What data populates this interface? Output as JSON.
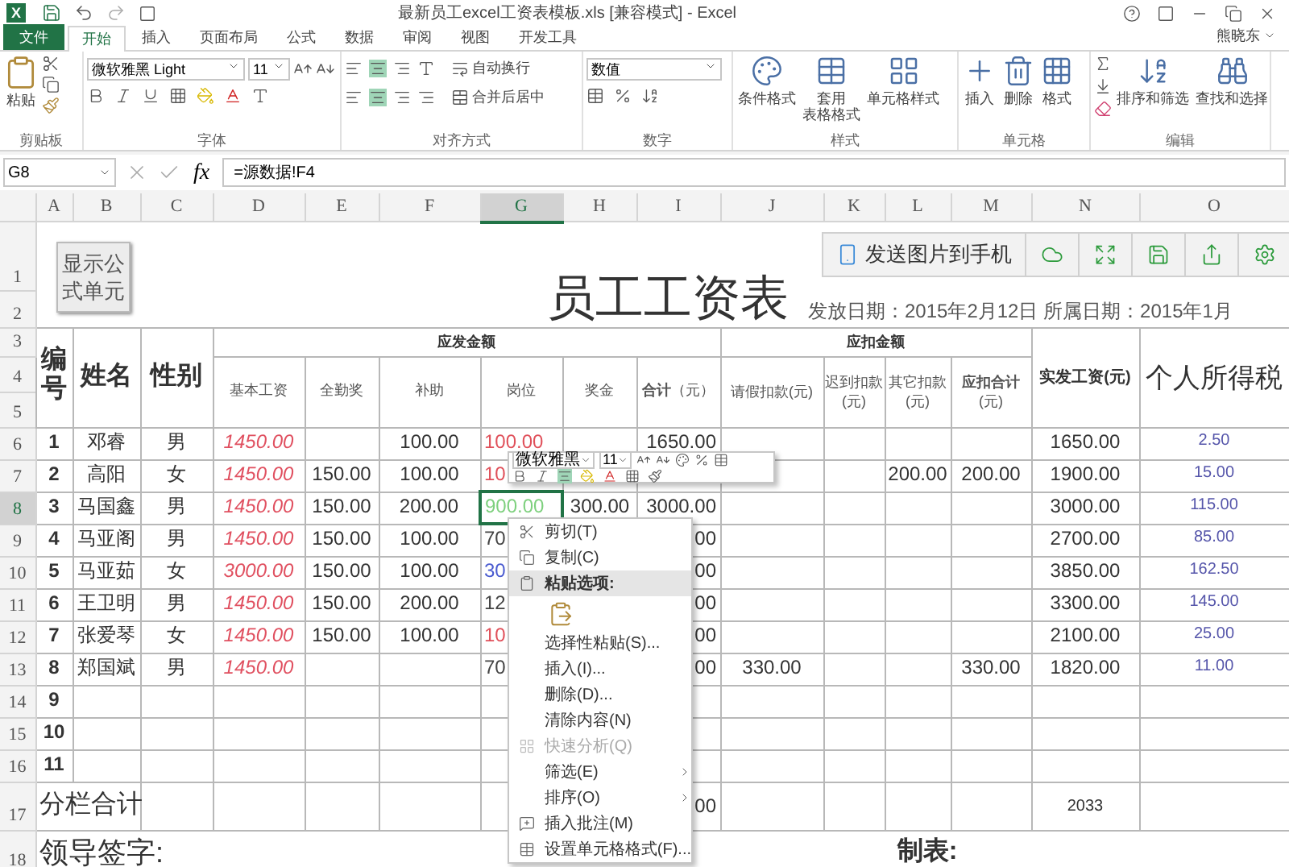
{
  "window": {
    "logo": "X",
    "title": "最新员工excel工资表模板.xls  [兼容模式] - Excel",
    "user": "熊晓东"
  },
  "tabs": [
    {
      "label": "文件",
      "kind": "file",
      "selected": false
    },
    {
      "label": "开始",
      "kind": "tab",
      "selected": true
    },
    {
      "label": "插入",
      "kind": "tab",
      "selected": false
    },
    {
      "label": "页面布局",
      "kind": "tab",
      "selected": false
    },
    {
      "label": "公式",
      "kind": "tab",
      "selected": false
    },
    {
      "label": "数据",
      "kind": "tab",
      "selected": false
    },
    {
      "label": "审阅",
      "kind": "tab",
      "selected": false
    },
    {
      "label": "视图",
      "kind": "tab",
      "selected": false
    },
    {
      "label": "开发工具",
      "kind": "tab",
      "selected": false
    }
  ],
  "ribbon": {
    "clipboard": {
      "paste": "粘贴",
      "group": "剪贴板"
    },
    "font": {
      "name": "微软雅黑 Light",
      "size": "11",
      "group": "字体"
    },
    "alignment": {
      "wrap": "自动换行",
      "merge": "合并后居中",
      "group": "对齐方式"
    },
    "number": {
      "format": "数值",
      "group": "数字"
    },
    "styles": {
      "buttons": [
        {
          "label": "条件格式"
        },
        {
          "label": "套用",
          "label_2": "表格格式"
        },
        {
          "label": "单元格样式"
        }
      ],
      "group": "样式"
    },
    "cells": {
      "buttons": [
        "插入",
        "删除",
        "格式"
      ],
      "group": "单元格"
    },
    "editing": {
      "buttons": [
        "排序和筛选",
        "查找和选择"
      ],
      "group": "编辑"
    }
  },
  "formula_bar": {
    "name_box": "G8",
    "function_button": "fx",
    "formula": "=源数据!F4"
  },
  "columns": [
    {
      "label": "A",
      "selected": false
    },
    {
      "label": "B",
      "selected": false
    },
    {
      "label": "C",
      "selected": false
    },
    {
      "label": "D",
      "selected": false
    },
    {
      "label": "E",
      "selected": false
    },
    {
      "label": "F",
      "selected": false
    },
    {
      "label": "G",
      "selected": true
    },
    {
      "label": "H",
      "selected": false
    },
    {
      "label": "I",
      "selected": false
    },
    {
      "label": "J",
      "selected": false
    },
    {
      "label": "K",
      "selected": false
    },
    {
      "label": "L",
      "selected": false
    },
    {
      "label": "M",
      "selected": false
    },
    {
      "label": "N",
      "selected": false
    },
    {
      "label": "O",
      "selected": false
    }
  ],
  "row_headers": [
    {
      "label": "1",
      "selected": false
    },
    {
      "label": "2",
      "selected": false
    },
    {
      "label": "3",
      "selected": false
    },
    {
      "label": "4",
      "selected": false
    },
    {
      "label": "5",
      "selected": false
    },
    {
      "label": "6",
      "selected": false
    },
    {
      "label": "7",
      "selected": false
    },
    {
      "label": "8",
      "selected": true
    },
    {
      "label": "9",
      "selected": false
    },
    {
      "label": "10",
      "selected": false
    },
    {
      "label": "11",
      "selected": false
    },
    {
      "label": "12",
      "selected": false
    },
    {
      "label": "13",
      "selected": false
    },
    {
      "label": "14",
      "selected": false
    },
    {
      "label": "15",
      "selected": false
    },
    {
      "label": "16",
      "selected": false
    },
    {
      "label": "17",
      "selected": false
    },
    {
      "label": "18",
      "selected": false
    }
  ],
  "formula_button": {
    "label": "显示公式单元"
  },
  "float_toolbar": {
    "send_label": "发送图片到手机"
  },
  "title_block": {
    "title": "员工工资表",
    "dates": "发放日期：2015年2月12日 所属日期：2015年1月"
  },
  "header": {
    "id": "编号",
    "name": "姓名",
    "gender": "性别",
    "earnings_group": "应发金额",
    "earnings": [
      "基本工资",
      "全勤奖",
      "补助",
      "岗位",
      "奖金",
      "**合计**（元）"
    ],
    "deductions_group": "应扣金额",
    "deductions": [
      "请假扣款(元)",
      "迟到扣款(元)",
      "其它扣款(元)",
      "**应扣合计**(元)"
    ],
    "net_pay": "实发工资(元)",
    "tax": "个人所得税"
  },
  "rows": [
    {
      "color": "#e0505a",
      "cells": [
        "1",
        "邓睿",
        "男",
        "1450.00",
        "",
        "100.00",
        "100.00",
        "",
        "1650.00",
        "",
        "",
        "",
        "",
        "1650.00",
        "2.50"
      ]
    },
    {
      "color": "#e0505a",
      "cells": [
        "2",
        "高阳",
        "女",
        "1450.00",
        "150.00",
        "100.00",
        "10",
        "",
        "",
        "",
        "",
        "200.00",
        "200.00",
        "1900.00",
        "15.00"
      ]
    },
    {
      "color": "#7ed07e",
      "cells": [
        "3",
        "马国鑫",
        "男",
        "1450.00",
        "150.00",
        "200.00",
        "900.00",
        "300.00",
        "3000.00",
        "",
        "",
        "",
        "",
        "3000.00",
        "115.00"
      ]
    },
    {
      "color": "#444444",
      "cells": [
        "4",
        "马亚阁",
        "男",
        "1450.00",
        "150.00",
        "100.00",
        "70",
        "",
        "00",
        "",
        "",
        "",
        "",
        "2700.00",
        "85.00"
      ]
    },
    {
      "color": "#4a5bd0",
      "cells": [
        "5",
        "马亚茹",
        "女",
        "3000.00",
        "150.00",
        "100.00",
        "30",
        "",
        "00",
        "",
        "",
        "",
        "",
        "3850.00",
        "162.50"
      ]
    },
    {
      "color": "#444444",
      "cells": [
        "6",
        "王卫明",
        "男",
        "1450.00",
        "150.00",
        "200.00",
        "12",
        "",
        "00",
        "",
        "",
        "",
        "",
        "3300.00",
        "145.00"
      ]
    },
    {
      "color": "#e0505a",
      "cells": [
        "7",
        "张爱琴",
        "女",
        "1450.00",
        "150.00",
        "100.00",
        "10",
        "",
        "00",
        "",
        "",
        "",
        "",
        "2100.00",
        "25.00"
      ]
    },
    {
      "color": "#444444",
      "cells": [
        "8",
        "郑国斌",
        "男",
        "1450.00",
        "",
        "",
        "70",
        "",
        "00",
        "330.00",
        "",
        "",
        "330.00",
        "1820.00",
        "11.00"
      ]
    },
    {
      "cells": [
        "9",
        "",
        "",
        "",
        "",
        "",
        "",
        "",
        "",
        "",
        "",
        "",
        "",
        "",
        ""
      ]
    },
    {
      "cells": [
        "10",
        "",
        "",
        "",
        "",
        "",
        "",
        "",
        "",
        "",
        "",
        "",
        "",
        "",
        ""
      ]
    },
    {
      "cells": [
        "11",
        "",
        "",
        "",
        "",
        "",
        "",
        "",
        "",
        "",
        "",
        "",
        "",
        "",
        ""
      ]
    }
  ],
  "subtotal": {
    "label": "分栏合计",
    "total": "00",
    "net_total": "2033"
  },
  "signatures": {
    "leader": "领导签字:",
    "preparer": "制表:"
  },
  "mini_toolbar": {
    "font": "微软雅黑",
    "size": "11"
  },
  "context_menu": [
    {
      "kind": "item",
      "label": "剪切(T)",
      "disabled": false,
      "highlighted": false
    },
    {
      "kind": "item",
      "label": "复制(C)",
      "disabled": false,
      "highlighted": false
    },
    {
      "kind": "header",
      "label": "粘贴选项:",
      "disabled": false,
      "highlighted": true
    },
    {
      "kind": "paste_icon",
      "disabled": false,
      "highlighted": false
    },
    {
      "kind": "item",
      "label": "选择性粘贴(S)...",
      "disabled": false,
      "highlighted": false
    },
    {
      "kind": "item",
      "label": "插入(I)...",
      "disabled": false,
      "highlighted": false
    },
    {
      "kind": "item",
      "label": "删除(D)...",
      "disabled": false,
      "highlighted": false
    },
    {
      "kind": "item",
      "label": "清除内容(N)",
      "disabled": false,
      "highlighted": false
    },
    {
      "kind": "item",
      "label": "快速分析(Q)",
      "disabled": true,
      "highlighted": false
    },
    {
      "kind": "submenu",
      "label": "筛选(E)",
      "disabled": false,
      "highlighted": false
    },
    {
      "kind": "submenu",
      "label": "排序(O)",
      "disabled": false,
      "highlighted": false
    },
    {
      "kind": "item",
      "label": "插入批注(M)",
      "disabled": false,
      "highlighted": false
    },
    {
      "kind": "item",
      "label": "设置单元格格式(F)...",
      "disabled": false,
      "highlighted": false
    }
  ]
}
